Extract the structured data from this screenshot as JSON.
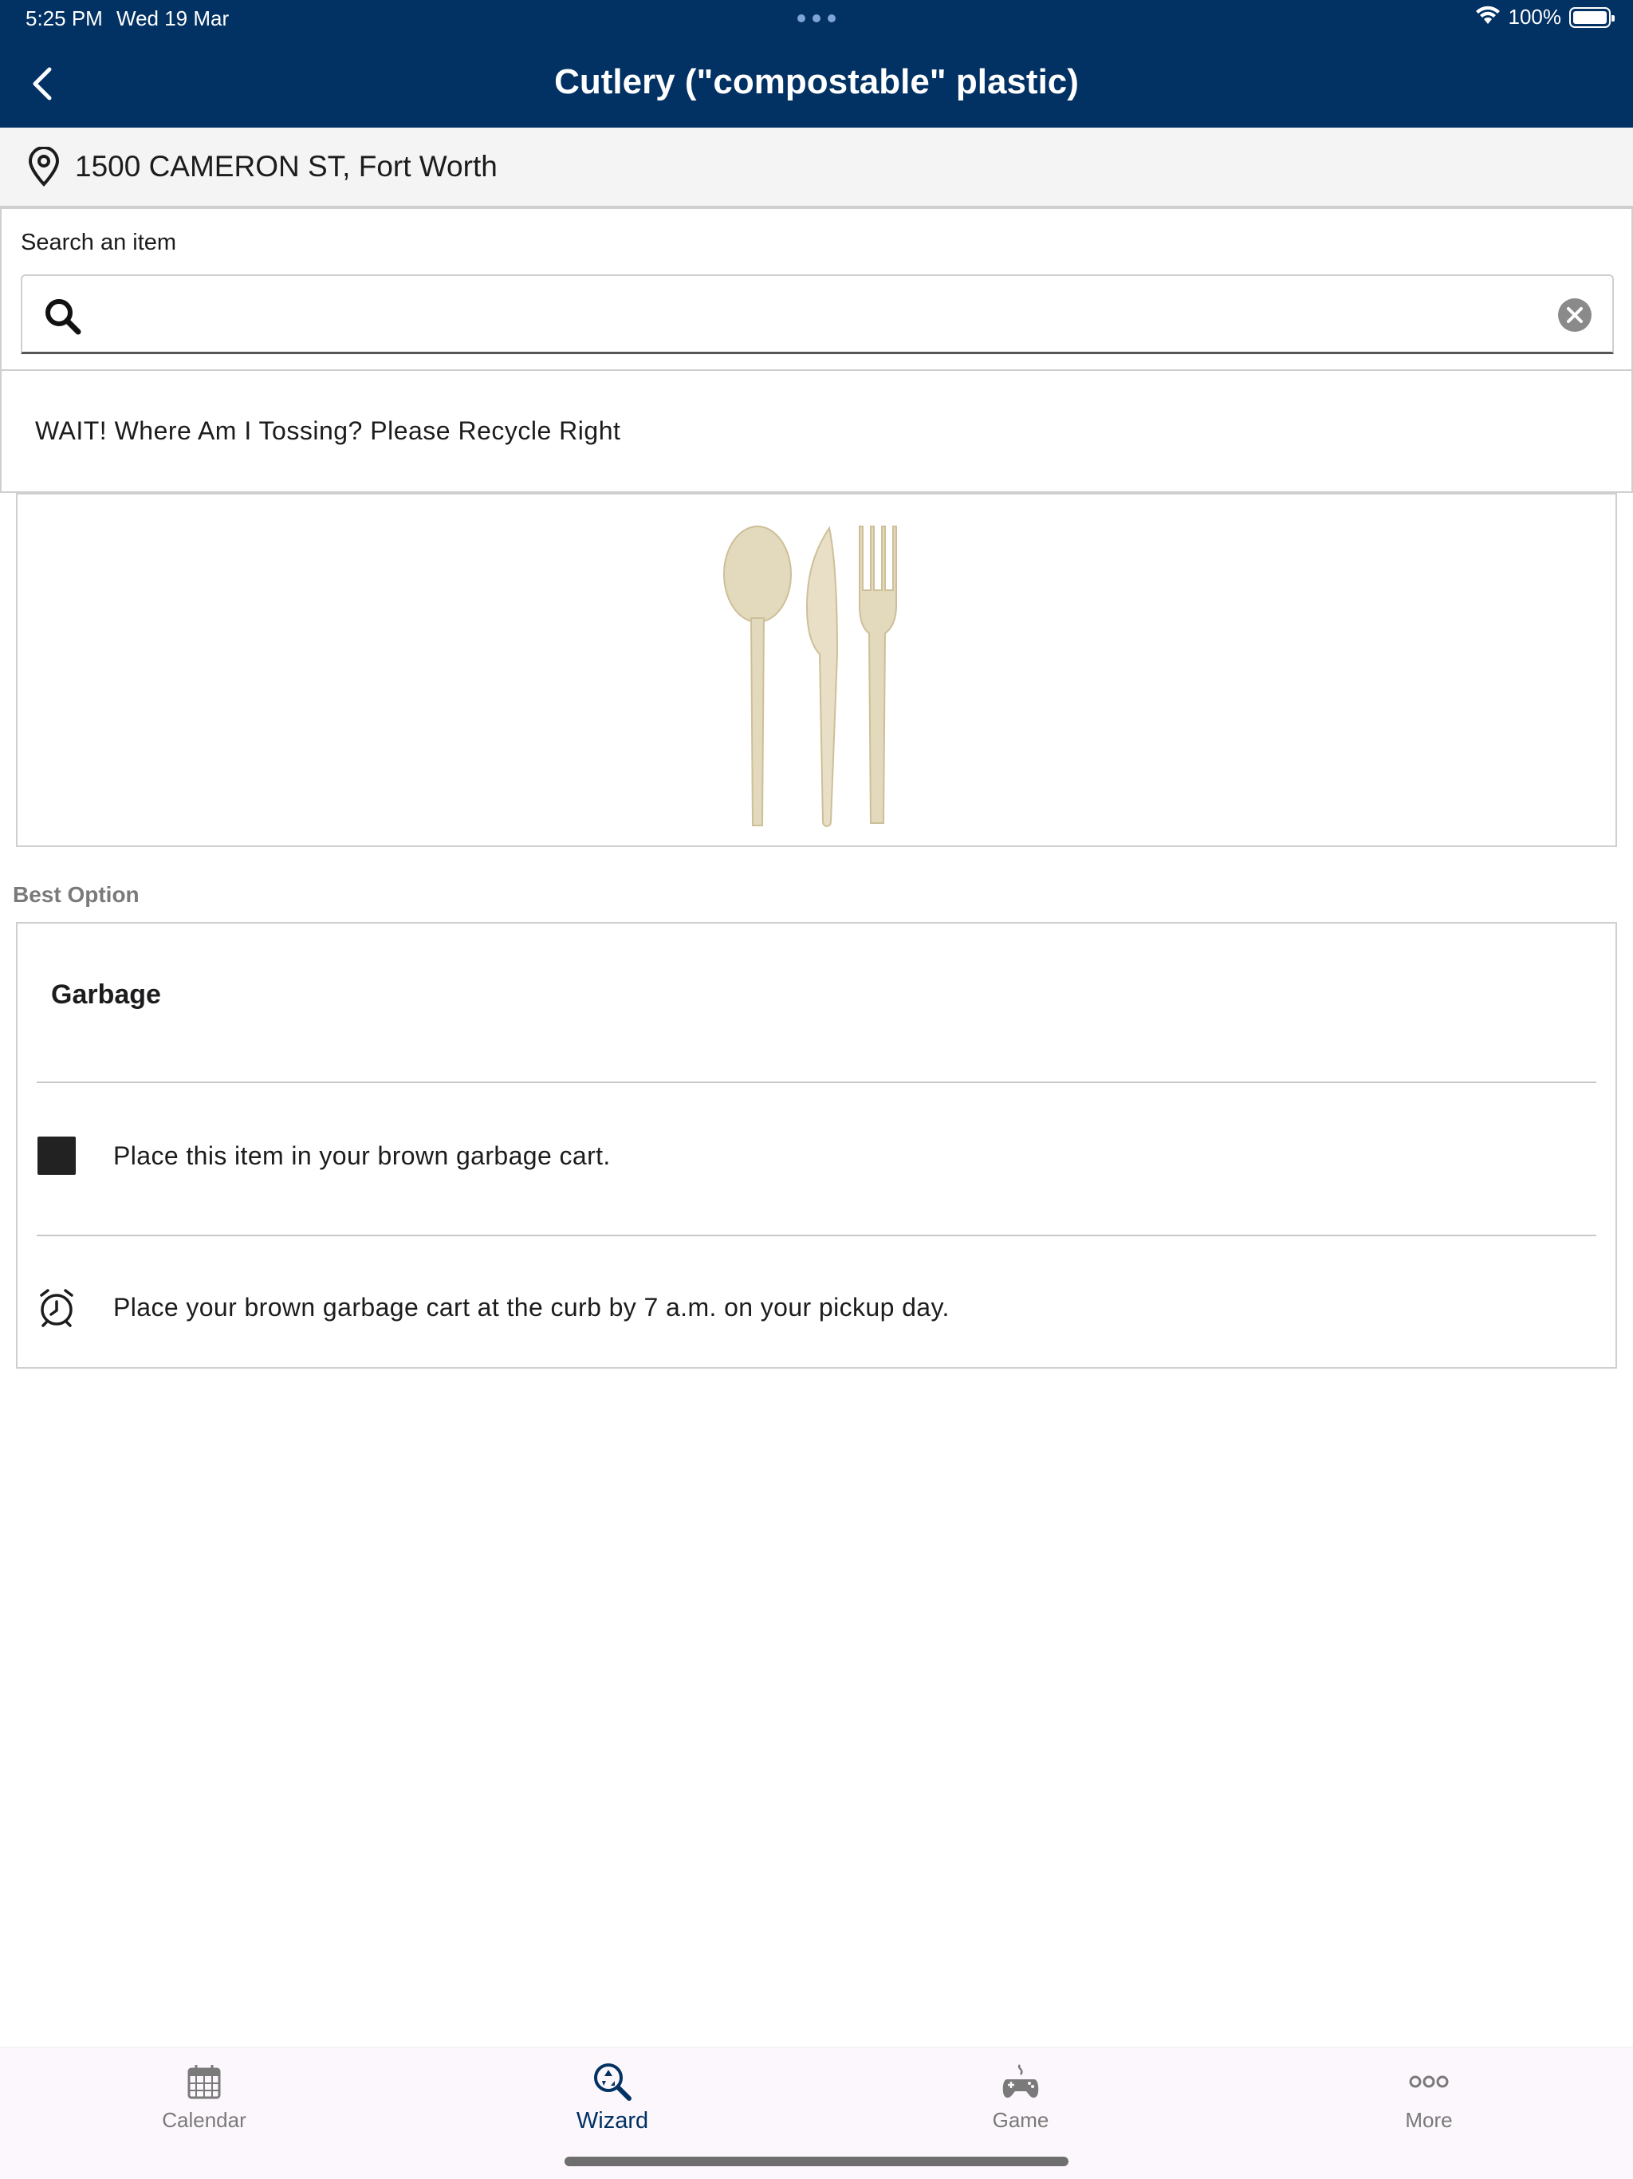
{
  "status_bar": {
    "time": "5:25 PM",
    "date": "Wed 19 Mar",
    "battery": "100%",
    "wifi_icon": "wifi-icon",
    "battery_icon": "battery-icon"
  },
  "header": {
    "title": "Cutlery (\"compostable\" plastic)",
    "back_icon": "chevron-left-icon",
    "background_color": "#023163"
  },
  "address": {
    "text": "1500 CAMERON ST, Fort Worth",
    "icon": "location-pin-icon"
  },
  "search": {
    "label": "Search an item",
    "value": "",
    "placeholder": "",
    "search_icon": "search-icon",
    "clear_icon": "clear-icon"
  },
  "banner": {
    "text": "WAIT! Where Am I Tossing? Please Recycle Right"
  },
  "item_image": {
    "description_icon": "cutlery-image"
  },
  "best_option": {
    "section_label": "Best Option",
    "title": "Garbage",
    "rows": [
      {
        "icon": "square-icon",
        "text": "Place this item in your brown garbage cart."
      },
      {
        "icon": "alarm-clock-icon",
        "text": "Place your brown garbage cart at the curb by 7 a.m. on your pickup day."
      }
    ]
  },
  "tab_bar": {
    "tabs": [
      {
        "label": "Calendar",
        "icon": "calendar-icon",
        "active": false
      },
      {
        "label": "Wizard",
        "icon": "wizard-search-icon",
        "active": true
      },
      {
        "label": "Game",
        "icon": "game-controller-icon",
        "active": false
      },
      {
        "label": "More",
        "icon": "more-icon",
        "active": false
      }
    ],
    "active_color": "#023163"
  }
}
